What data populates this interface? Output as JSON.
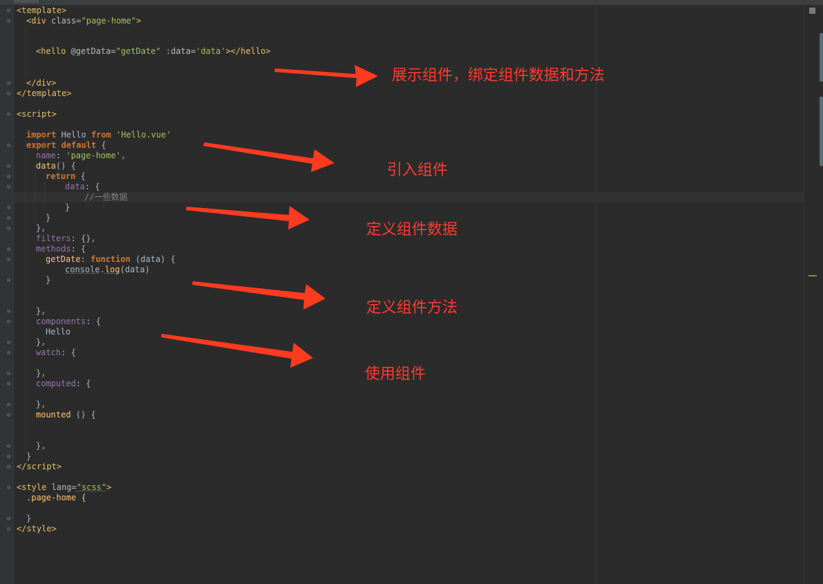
{
  "editor": {
    "code": {
      "l1": {
        "open": "<",
        "name": "template",
        "close": ">"
      },
      "l2": {
        "open": "<",
        "name": "div",
        "attr": " class=",
        "value": "\"page-home\"",
        "close": ">"
      },
      "l3": {
        "open": "<",
        "name": "hello",
        "attr1": " @getData=",
        "value1": "\"getDate\"",
        "attr2": " :data=",
        "value2": "'data'",
        "mid": "></",
        "name2": "hello",
        "close": ">"
      },
      "l4": {
        "open": "</",
        "name": "div",
        "close": ">"
      },
      "l5": {
        "open": "</",
        "name": "template",
        "close": ">"
      },
      "l6": {
        "open": "<",
        "name": "script",
        "close": ">"
      },
      "l7": {
        "kw1": "import",
        "t1": " Hello ",
        "kw2": "from",
        "sp": " ",
        "str": "'Hello.vue'"
      },
      "l8": {
        "kw1": "export",
        "sp": " ",
        "kw2": "default",
        "t": " {"
      },
      "l9": {
        "prop": "name",
        "t": ": ",
        "str": "'page-home'",
        "end": ","
      },
      "l10": {
        "fn": "data",
        "t": "() {"
      },
      "l11": {
        "kw": "return",
        "t": " {"
      },
      "l12": {
        "prop": "data",
        "t": ": {"
      },
      "l13": {
        "comment": "//一些数据"
      },
      "l14": {
        "t": "}"
      },
      "l15": {
        "t": "}"
      },
      "l16": {
        "t": "}",
        "end": ","
      },
      "l17": {
        "prop": "filters",
        "t": ": {}",
        "end": ","
      },
      "l18": {
        "prop": "methods",
        "t": ": {"
      },
      "l19": {
        "fn": "getDate",
        "t1": ": ",
        "kw": "function",
        "t2": " (data) {"
      },
      "l20": {
        "obj": "console",
        "dot": ".",
        "fn": "log",
        "t": "(data)"
      },
      "l21": {
        "t": "}"
      },
      "l22": {
        "t": "}",
        "end": ","
      },
      "l23": {
        "prop": "components",
        "t": ": {"
      },
      "l24": {
        "t": "Hello"
      },
      "l25": {
        "t": "}",
        "end": ","
      },
      "l26": {
        "prop": "watch",
        "t": ": {"
      },
      "l27": {
        "t": "}",
        "end": ","
      },
      "l28": {
        "prop": "computed",
        "t": ": {"
      },
      "l29": {
        "t": "}",
        "end": ","
      },
      "l30": {
        "fn": "mounted",
        "t": " () {"
      },
      "l31": {
        "t": "}",
        "end": ","
      },
      "l32": {
        "t": "}"
      },
      "l33": {
        "open": "</",
        "name": "script",
        "close": ">"
      },
      "l34": {
        "open": "<",
        "name": "style",
        "attr": " lang=",
        "value": "\"scss\"",
        "close": ">"
      },
      "l35": {
        "t": ".page-home {"
      },
      "l36": {
        "t": "}"
      },
      "l37": {
        "open": "</",
        "name": "style",
        "close": ">"
      }
    }
  },
  "annotations": [
    {
      "text": "展示组件，绑定组件数据和方法"
    },
    {
      "text": "引入组件"
    },
    {
      "text": "定义组件数据"
    },
    {
      "text": "定义组件方法"
    },
    {
      "text": "使用组件"
    }
  ],
  "colors": {
    "background": "#2b2b2b",
    "annotation": "#ff3b2f",
    "tag": "#e8bf6a",
    "string": "#a5c25c",
    "keyword": "#cc7832",
    "property": "#9876aa",
    "function": "#ffc66d",
    "comment": "#808080"
  }
}
